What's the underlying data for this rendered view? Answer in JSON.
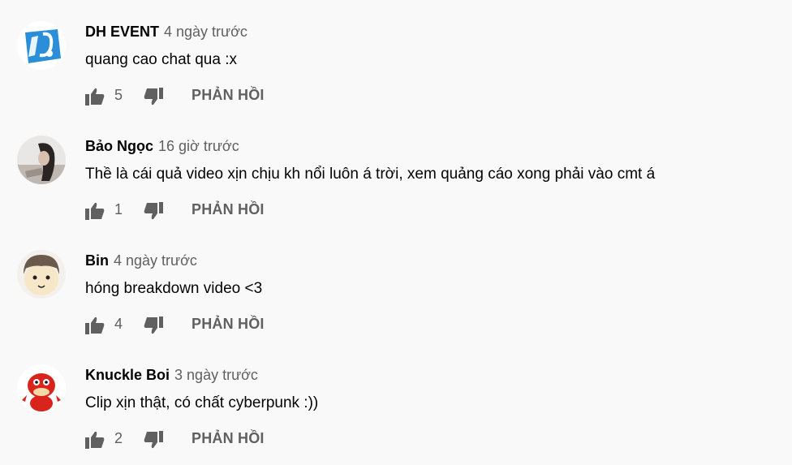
{
  "comments": [
    {
      "author": "DH EVENT",
      "time": "4 ngày trước",
      "text": "quang cao chat qua :x",
      "likes": "5",
      "reply_label": "PHẢN HỒI",
      "avatar": "dh-event-logo"
    },
    {
      "author": "Bảo Ngọc",
      "time": "16 giờ trước",
      "text": "Thề là cái quả video xịn chịu kh nổi luôn á trời, xem quảng cáo xong phải vào cmt á",
      "likes": "1",
      "reply_label": "PHẢN HỒI",
      "avatar": "photo-girl"
    },
    {
      "author": "Bin",
      "time": "4 ngày trước",
      "text": "hóng breakdown video <3",
      "likes": "4",
      "reply_label": "PHẢN HỒI",
      "avatar": "cartoon-face"
    },
    {
      "author": "Knuckle Boi",
      "time": "3 ngày trước",
      "text": "Clip xịn thật, có chất cyberpunk :))",
      "likes": "2",
      "reply_label": "PHẢN HỒI",
      "avatar": "red-knuckles-character"
    }
  ],
  "icons": {
    "like": "thumb-up-icon",
    "dislike": "thumb-down-icon"
  },
  "colors": {
    "background": "#f9f9f9",
    "text": "#030303",
    "secondary": "#606060",
    "logo_blue": "#2a8fd8"
  }
}
